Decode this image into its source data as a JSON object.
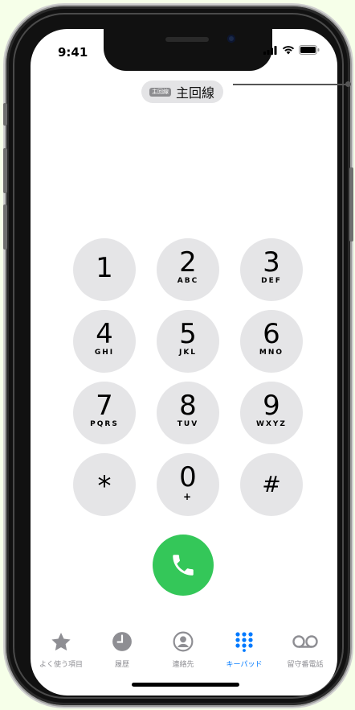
{
  "status": {
    "time": "9:41"
  },
  "line_selector": {
    "badge": "主回線",
    "label": "主回線"
  },
  "keypad": {
    "keys": [
      {
        "digit": "1",
        "letters": ""
      },
      {
        "digit": "2",
        "letters": "ABC"
      },
      {
        "digit": "3",
        "letters": "DEF"
      },
      {
        "digit": "4",
        "letters": "GHI"
      },
      {
        "digit": "5",
        "letters": "JKL"
      },
      {
        "digit": "6",
        "letters": "MNO"
      },
      {
        "digit": "7",
        "letters": "PQRS"
      },
      {
        "digit": "8",
        "letters": "TUV"
      },
      {
        "digit": "9",
        "letters": "WXYZ"
      },
      {
        "digit": "*",
        "letters": ""
      },
      {
        "digit": "0",
        "letters": "+"
      },
      {
        "digit": "#",
        "letters": ""
      }
    ],
    "call_icon": "phone-icon",
    "colors": {
      "key_bg": "#e5e5e7",
      "call_green": "#34c759"
    }
  },
  "tabbar": {
    "tabs": [
      {
        "label": "よく使う項目",
        "icon": "star-icon"
      },
      {
        "label": "履歴",
        "icon": "clock-icon"
      },
      {
        "label": "連絡先",
        "icon": "person-circle-icon"
      },
      {
        "label": "キーパッド",
        "icon": "keypad-icon"
      },
      {
        "label": "留守番電話",
        "icon": "voicemail-icon"
      }
    ],
    "active_tab": "キーパッド",
    "colors": {
      "active": "#007aff",
      "inactive": "#8e8e93"
    }
  }
}
